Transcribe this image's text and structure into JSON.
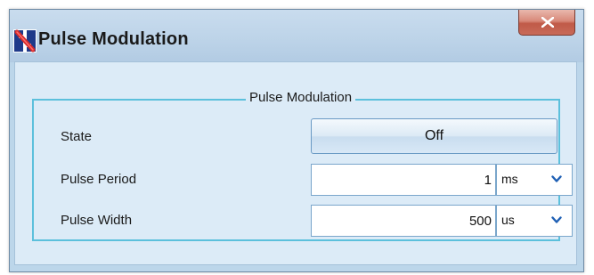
{
  "window": {
    "title": "Pulse Modulation",
    "app_icon": "app-logo-icon",
    "close_icon": "close-icon"
  },
  "group": {
    "legend": "Pulse Modulation"
  },
  "state": {
    "label": "State",
    "button_label": "Off"
  },
  "pulse_period": {
    "label": "Pulse Period",
    "value": "1",
    "unit": "ms"
  },
  "pulse_width": {
    "label": "Pulse Width",
    "value": "500",
    "unit": "us"
  },
  "colors": {
    "title_bg": "#bcd3e8",
    "client_bg": "#dcebf7",
    "group_border": "#5cc0dc",
    "close_red": "#c05a48",
    "dropdown_chevron": "#1e5fb4"
  }
}
